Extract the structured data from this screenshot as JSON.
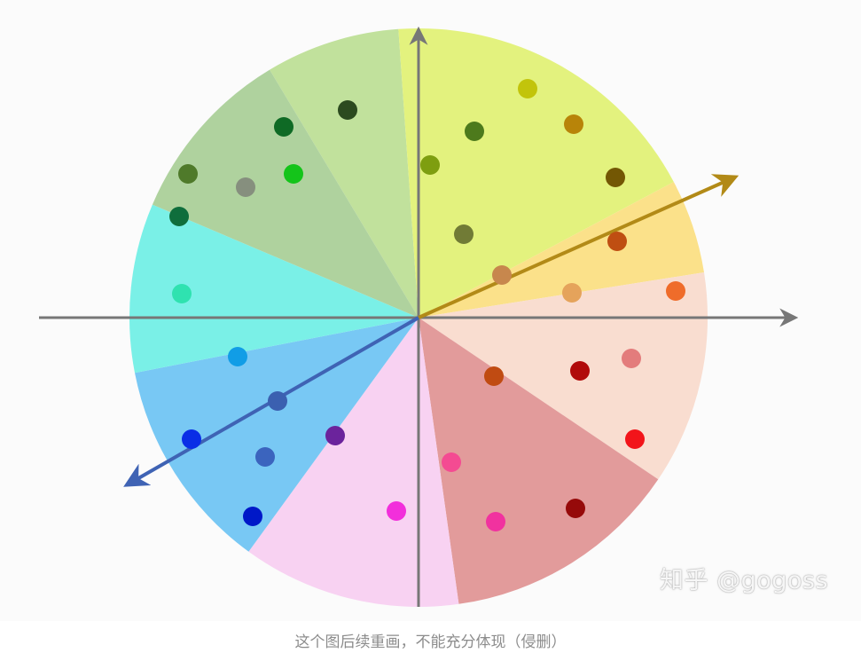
{
  "watermark": "知乎 @gogoss",
  "caption": "这个图后续重画，不能充分体现（侵删）",
  "colors": {
    "axis": "#777777",
    "arrow_gold": "#b28a17",
    "arrow_blue": "#3f63b4"
  },
  "sectors": [
    {
      "name": "light-green",
      "fill": "#c1e19c"
    },
    {
      "name": "yellow-green",
      "fill": "#e3f27e"
    },
    {
      "name": "light-orange",
      "fill": "#fbe18a"
    },
    {
      "name": "peach",
      "fill": "#f9ddd0"
    },
    {
      "name": "rose",
      "fill": "#e29b9b"
    },
    {
      "name": "pink",
      "fill": "#f8d2f2"
    },
    {
      "name": "sky-blue",
      "fill": "#78c8f4"
    },
    {
      "name": "cyan",
      "fill": "#7af0e7"
    },
    {
      "name": "sage",
      "fill": "#afd29e"
    }
  ],
  "dots": [
    {
      "color": "#2c4a1f"
    },
    {
      "color": "#0f6a25"
    },
    {
      "color": "#4f7a2a"
    },
    {
      "color": "#868f7e"
    },
    {
      "color": "#14c41a"
    },
    {
      "color": "#0f6e3c"
    },
    {
      "color": "#2fe2b0"
    },
    {
      "color": "#c2c40b"
    },
    {
      "color": "#4d7a1c"
    },
    {
      "color": "#b88409"
    },
    {
      "color": "#7e9e10"
    },
    {
      "color": "#717b36"
    },
    {
      "color": "#735704"
    },
    {
      "color": "#bf4e12"
    },
    {
      "color": "#c7874d"
    },
    {
      "color": "#e5a35b"
    },
    {
      "color": "#ef6c2a"
    },
    {
      "color": "#c04b12"
    },
    {
      "color": "#b10b0b"
    },
    {
      "color": "#e37c7c"
    },
    {
      "color": "#f2141a"
    },
    {
      "color": "#960a0a"
    },
    {
      "color": "#f44b92"
    },
    {
      "color": "#f1329f"
    },
    {
      "color": "#f22fdb"
    },
    {
      "color": "#6b239c"
    },
    {
      "color": "#119de6"
    },
    {
      "color": "#3b60b0"
    },
    {
      "color": "#0a2ee6"
    },
    {
      "color": "#3b64be"
    },
    {
      "color": "#0018c8"
    }
  ]
}
